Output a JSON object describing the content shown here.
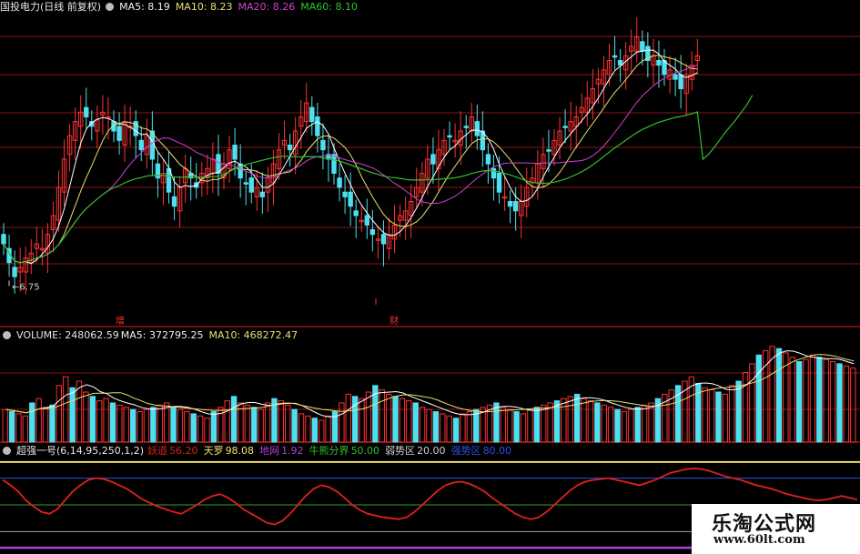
{
  "main_header": {
    "title": "国投电力(日线 前复权)",
    "ma5": "MA5: 8.19",
    "ma10": "MA10: 8.23",
    "ma20": "MA20: 8.26",
    "ma60": "MA60: 8.10"
  },
  "volume_header": {
    "volume": "VOLUME: 248062.59",
    "ma5": "MA5: 372795.25",
    "ma10": "MA10: 468272.47"
  },
  "indicator_header": {
    "name": "超强一号(6,14,95,250,1,2)",
    "l1": "妖道",
    "v1": "56.20",
    "l2": "天罗",
    "v2": "98.08",
    "l3": "地网",
    "v3": "1.92",
    "l4": "牛熊分界",
    "v4": "50.00",
    "l5": "弱势区",
    "v5": "20.00",
    "l6": "强势区",
    "v6": "80.00"
  },
  "markers": {
    "low_price_label": "6.75",
    "event_1": "增",
    "event_2": "财"
  },
  "watermark": {
    "title": "乐淘公式网",
    "url": "www.60lt.com"
  },
  "colors": {
    "up": "#ff3030",
    "down": "#4ee0f0",
    "ma5": "#ffffff",
    "ma10": "#e8e070",
    "ma20": "#d040d0",
    "ma60": "#30c030",
    "grid": "#8a1414",
    "yaodao": "#e02020",
    "tianluo": "#f0e070",
    "diwang": "#b040d0",
    "strong": "#3050e0",
    "bull_bear": "#30a030",
    "weak": "#a0a0a0"
  },
  "chart_data": {
    "type": "candlestick",
    "series_main": {
      "closes": [
        7.2,
        7.0,
        6.85,
        6.95,
        7.05,
        7.1,
        7.2,
        7.15,
        7.3,
        7.5,
        7.8,
        8.1,
        8.35,
        8.5,
        8.6,
        8.55,
        8.45,
        8.52,
        8.6,
        8.55,
        8.4,
        8.3,
        8.5,
        8.45,
        8.35,
        8.2,
        8.35,
        8.1,
        7.9,
        7.95,
        7.75,
        7.6,
        7.8,
        8.0,
        7.9,
        7.8,
        7.95,
        8.0,
        8.1,
        7.95,
        8.05,
        8.2,
        8.1,
        7.9,
        7.85,
        7.75,
        7.8,
        7.7,
        7.9,
        8.05,
        8.2,
        8.3,
        8.2,
        8.4,
        8.55,
        8.7,
        8.5,
        8.35,
        8.2,
        8.1,
        7.95,
        7.8,
        7.7,
        7.6,
        7.5,
        7.45,
        7.4,
        7.3,
        7.25,
        7.2,
        7.3,
        7.4,
        7.5,
        7.55,
        7.65,
        7.8,
        7.95,
        8.1,
        8.05,
        8.2,
        8.3,
        8.35,
        8.3,
        8.4,
        8.45,
        8.55,
        8.35,
        8.2,
        8.05,
        7.9,
        7.75,
        7.7,
        7.6,
        7.55,
        7.65,
        7.8,
        7.9,
        8.05,
        8.15,
        8.2,
        8.3,
        8.4,
        8.45,
        8.5,
        8.55,
        8.65,
        8.75,
        8.85,
        8.95,
        9.05,
        9.15,
        9.2,
        9.1,
        9.2,
        9.3,
        9.4,
        9.25,
        9.15,
        9.2,
        9.1,
        9.0,
        9.05,
        8.95,
        8.85,
        9.0,
        9.1,
        9.2
      ],
      "ma60_tail": [
        8.1,
        8.15,
        8.22,
        8.3,
        8.38,
        8.45,
        8.52,
        8.6,
        8.68,
        8.78
      ],
      "price_low": 6.75
    },
    "volume": {
      "values": [
        150,
        140,
        130,
        120,
        180,
        200,
        160,
        170,
        260,
        300,
        250,
        280,
        230,
        210,
        190,
        200,
        180,
        170,
        160,
        150,
        140,
        150,
        160,
        170,
        180,
        160,
        150,
        140,
        130,
        120,
        110,
        140,
        160,
        190,
        210,
        180,
        170,
        160,
        150,
        180,
        200,
        190,
        170,
        150,
        130,
        120,
        110,
        100,
        120,
        140,
        180,
        220,
        210,
        200,
        230,
        260,
        240,
        220,
        210,
        200,
        190,
        180,
        160,
        150,
        140,
        130,
        120,
        110,
        130,
        140,
        150,
        160,
        170,
        180,
        160,
        150,
        140,
        130,
        150,
        160,
        170,
        180,
        190,
        200,
        210,
        220,
        200,
        190,
        180,
        170,
        160,
        150,
        140,
        150,
        160,
        170,
        180,
        200,
        220,
        240,
        260,
        280,
        300,
        270,
        250,
        240,
        230,
        220,
        260,
        280,
        320,
        360,
        400,
        420,
        440,
        430,
        410,
        390,
        370,
        380,
        400,
        390,
        380,
        370,
        360,
        350,
        340
      ],
      "ma5": 372795.25,
      "ma10": 468272.47,
      "latest": 248062.59
    },
    "indicator": {
      "yaodao": [
        78,
        72,
        65,
        55,
        48,
        42,
        40,
        45,
        55,
        65,
        72,
        78,
        80,
        79,
        76,
        72,
        68,
        62,
        56,
        52,
        48,
        45,
        42,
        40,
        45,
        50,
        56,
        60,
        62,
        58,
        52,
        45,
        40,
        35,
        30,
        28,
        32,
        40,
        50,
        60,
        68,
        72,
        70,
        65,
        58,
        50,
        44,
        40,
        38,
        36,
        35,
        34,
        36,
        42,
        50,
        58,
        66,
        72,
        75,
        76,
        74,
        70,
        65,
        58,
        52,
        46,
        40,
        36,
        34,
        36,
        42,
        50,
        58,
        66,
        72,
        76,
        78,
        79,
        80,
        78,
        76,
        74,
        72,
        75,
        78,
        82,
        86,
        88,
        90,
        91,
        90,
        88,
        85,
        82,
        80,
        78,
        75,
        72,
        70,
        68,
        65,
        62,
        60,
        58,
        56,
        55,
        56,
        58,
        60,
        58,
        56
      ],
      "tianluo": 98.08,
      "diwang": 1.92,
      "bull_bear": 50.0,
      "weak": 20.0,
      "strong": 80.0
    }
  }
}
